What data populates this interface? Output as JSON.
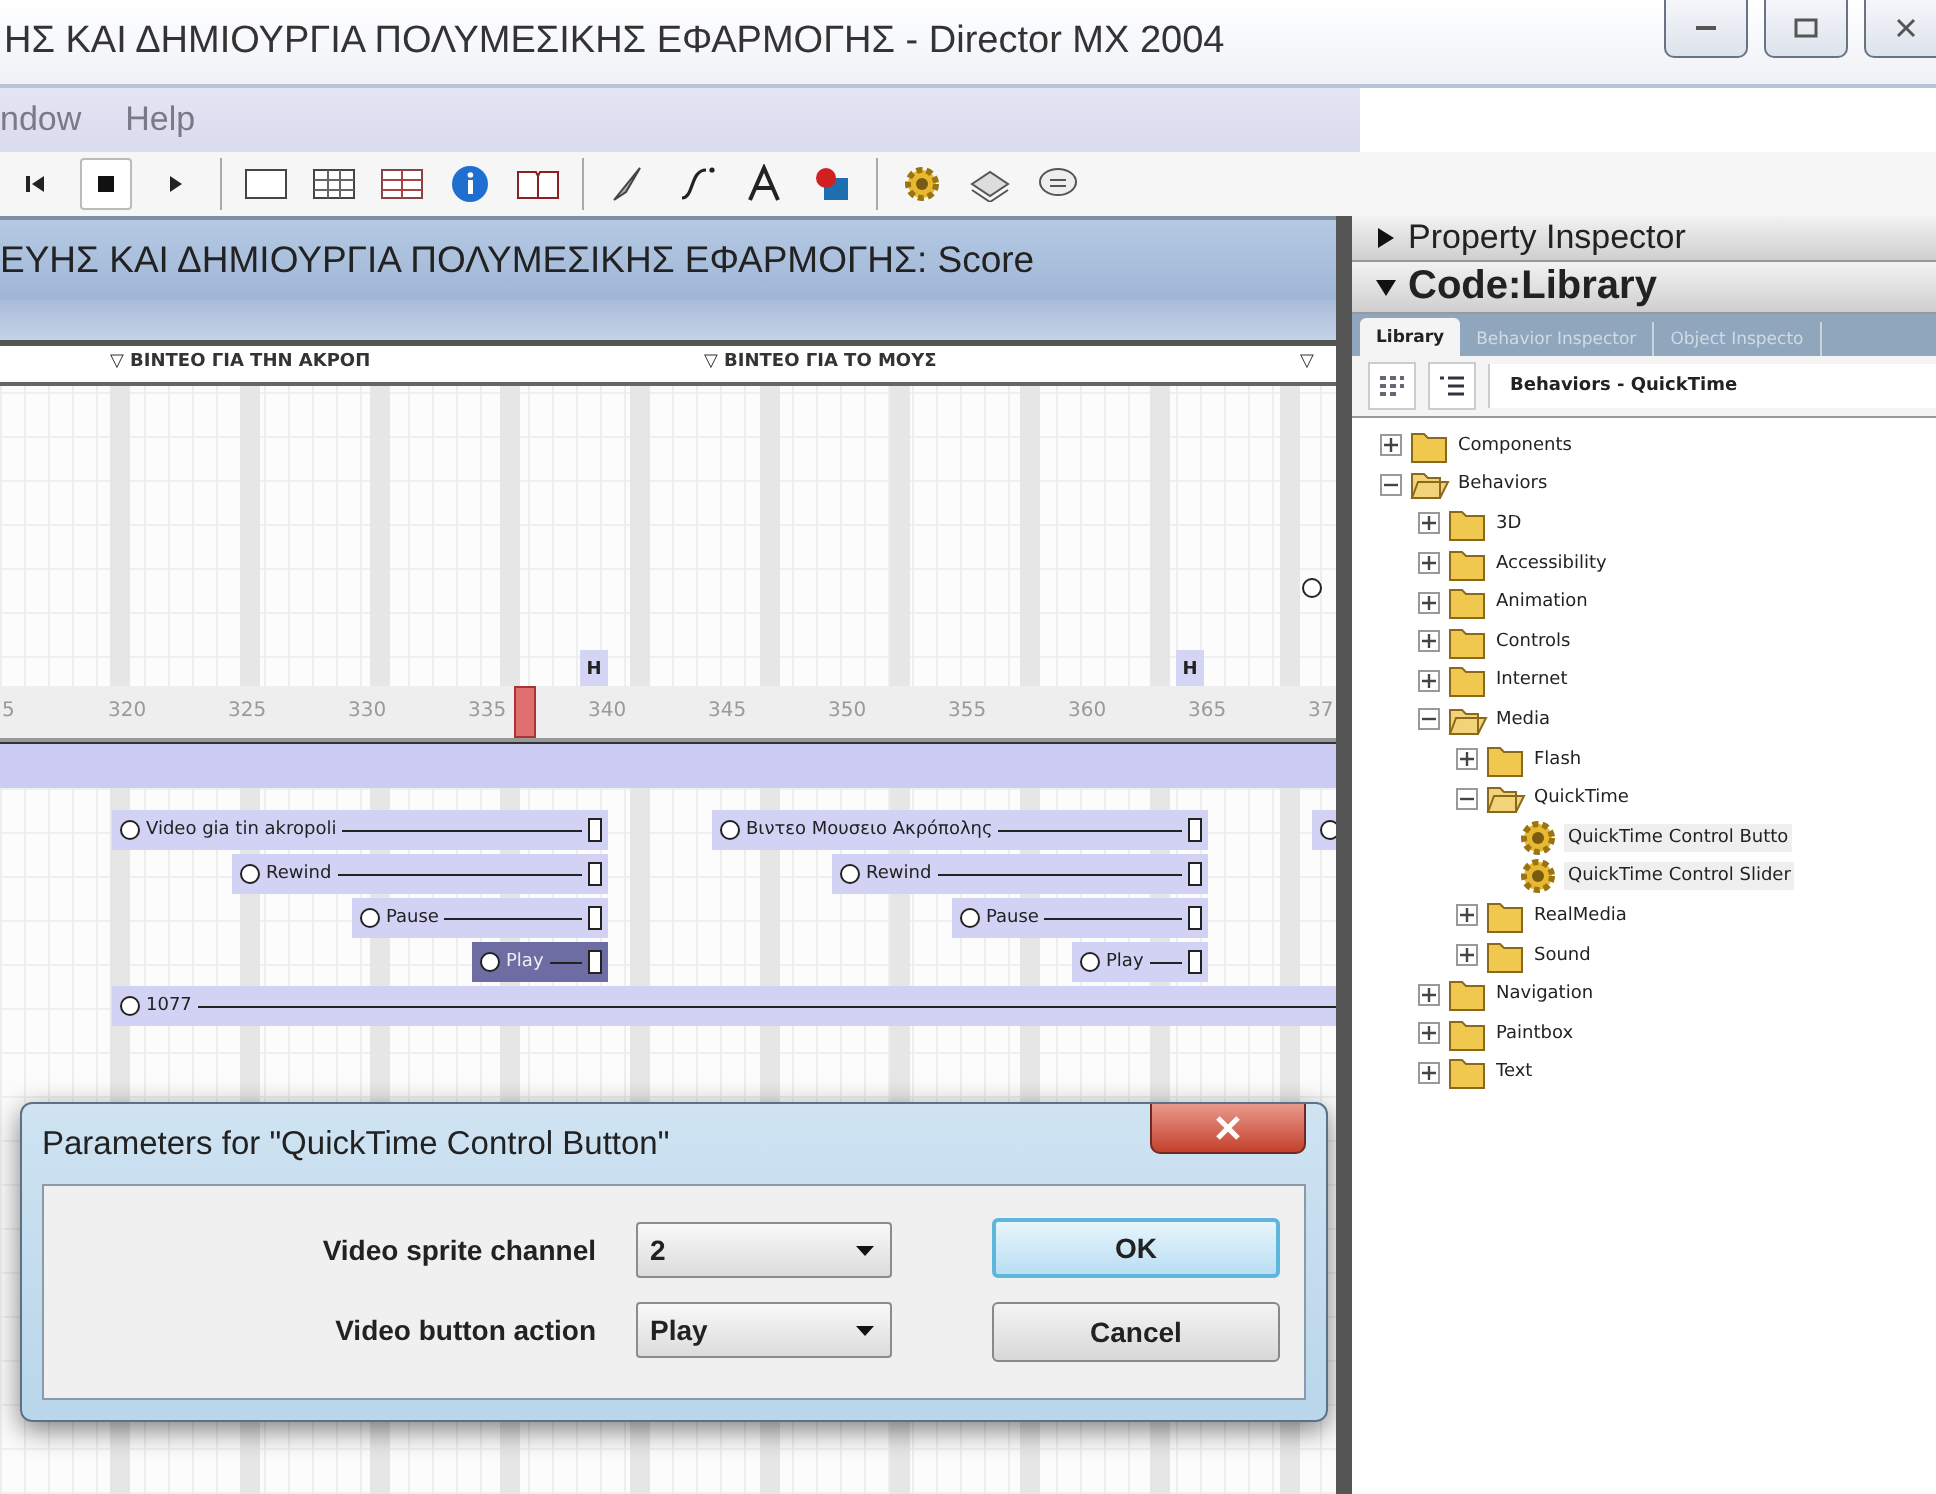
{
  "window": {
    "title": "ΗΣ ΚΑΙ ΔΗΜΙΟΥΡΓΙΑ ΠΟΛΥΜΕΣΙΚΗΣ ΕΦΑΡΜΟΓΗΣ - Director MX 2004"
  },
  "menu": [
    "ndow",
    "Help"
  ],
  "score": {
    "title": "ΕΥΗΣ ΚΑΙ ΔΗΜΙΟΥΡΓΙΑ ΠΟΛΥΜΕΣΙΚΗΣ ΕΦΑΡΜΟΓΗΣ: Score",
    "markers": [
      {
        "label": "▽ ΒΙΝΤΕΟ ΓΙΑ ΤΗΝ ΑΚΡΟΠ"
      },
      {
        "label": "▽ ΒΙΝΤΕΟ ΓΙΑ ΤΟ ΜΟΥΣ"
      },
      {
        "label": "▽"
      }
    ],
    "frame_script_marks": [
      "H",
      "H"
    ],
    "ruler": [
      "5",
      "320",
      "325",
      "330",
      "335",
      "340",
      "345",
      "350",
      "355",
      "360",
      "365",
      "37"
    ],
    "channels": [
      {
        "sprites": [
          {
            "label": "Video gia tin akropoli",
            "selected": false
          },
          {
            "label": "Βιντεο Μουσειο Ακρόπολης",
            "selected": false
          },
          {
            "selected": false
          }
        ]
      },
      {
        "sprites": [
          {
            "label": "Rewind",
            "selected": false
          },
          {
            "label": "Rewind",
            "selected": false
          }
        ]
      },
      {
        "sprites": [
          {
            "label": "Pause",
            "selected": false
          },
          {
            "label": "Pause",
            "selected": false
          }
        ]
      },
      {
        "sprites": [
          {
            "label": "Play",
            "selected": true
          },
          {
            "label": "Play",
            "selected": false
          }
        ]
      },
      {
        "sprites": [
          {
            "label": "1077",
            "selected": false
          }
        ]
      }
    ]
  },
  "panels": [
    {
      "title": "Property Inspector",
      "expanded": false
    },
    {
      "title": "Code:Library",
      "expanded": true
    }
  ],
  "library": {
    "tabs": [
      {
        "label": "Library",
        "selected": true
      },
      {
        "label": "Behavior Inspector",
        "selected": false
      },
      {
        "label": "Object Inspecto",
        "selected": false
      }
    ],
    "category": "Behaviors - QuickTime",
    "tree": [
      {
        "label": "Components",
        "kind": "folder",
        "expanded": false
      },
      {
        "label": "Behaviors",
        "kind": "folder",
        "expanded": true,
        "children": [
          {
            "label": "3D",
            "kind": "folder",
            "expanded": false
          },
          {
            "label": "Accessibility",
            "kind": "folder",
            "expanded": false
          },
          {
            "label": "Animation",
            "kind": "folder",
            "expanded": false
          },
          {
            "label": "Controls",
            "kind": "folder",
            "expanded": false
          },
          {
            "label": "Internet",
            "kind": "folder",
            "expanded": false
          },
          {
            "label": "Media",
            "kind": "folder",
            "expanded": true,
            "children": [
              {
                "label": "Flash",
                "kind": "folder",
                "expanded": false
              },
              {
                "label": "QuickTime",
                "kind": "folder",
                "expanded": true,
                "children": [
                  {
                    "label": "QuickTime Control Butto",
                    "kind": "behavior"
                  },
                  {
                    "label": "QuickTime Control Slider",
                    "kind": "behavior"
                  }
                ]
              },
              {
                "label": "RealMedia",
                "kind": "folder",
                "expanded": false
              },
              {
                "label": "Sound",
                "kind": "folder",
                "expanded": false
              }
            ]
          },
          {
            "label": "Navigation",
            "kind": "folder",
            "expanded": false
          },
          {
            "label": "Paintbox",
            "kind": "folder",
            "expanded": false
          },
          {
            "label": "Text",
            "kind": "folder",
            "expanded": false
          }
        ]
      }
    ]
  },
  "dialog": {
    "title": "Parameters for \"QuickTime Control Button\"",
    "fields": [
      {
        "label": "Video sprite channel",
        "value": "2"
      },
      {
        "label": "Video button action",
        "value": "Play"
      }
    ],
    "buttons": [
      {
        "label": "OK",
        "default": true
      },
      {
        "label": "Cancel",
        "default": false
      }
    ]
  }
}
